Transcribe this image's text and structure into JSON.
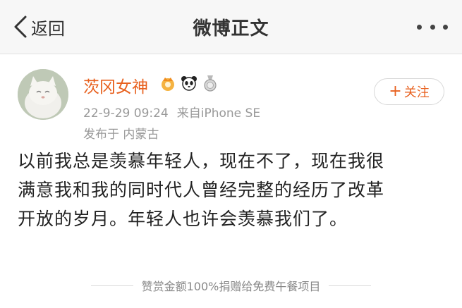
{
  "nav": {
    "back_label": "返回",
    "title": "微博正文"
  },
  "post": {
    "username": "茨冈女神",
    "follow_label": "关注",
    "follow_plus": "+",
    "time": "22-9-29 09:24",
    "source": "来自iPhone SE",
    "location": "发布于 内蒙古",
    "lines": [
      "以前我总是羡慕年轻人，现在不了，现在我很",
      "满意我和我的同时代人曾经完整的经历了改革",
      "开放的岁月。年轻人也许会羡慕我们了。"
    ]
  },
  "footer": {
    "text": "赞赏金额100%捐赠给免费午餐项目"
  },
  "colors": {
    "accent": "#e8611f",
    "meta": "#999999"
  },
  "icons": [
    "chevron-left-icon",
    "more-dots-icon",
    "crown-badge-icon",
    "panda-badge-icon",
    "medal-badge-icon"
  ]
}
